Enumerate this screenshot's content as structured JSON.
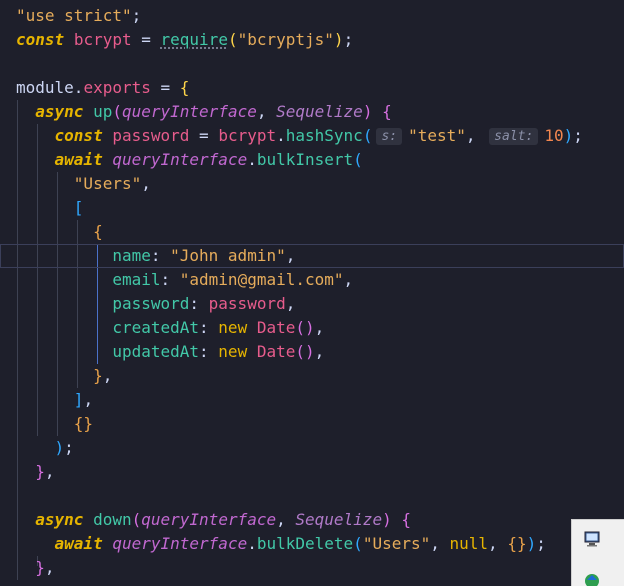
{
  "editor": {
    "lines": [
      {
        "tokens": [
          {
            "t": "\"use strict\"",
            "c": "str"
          },
          {
            "t": ";",
            "c": "pl"
          }
        ]
      },
      {
        "tokens": [
          {
            "t": "const",
            "c": "kw"
          },
          {
            "t": " ",
            "c": "pl"
          },
          {
            "t": "bcrypt",
            "c": "var"
          },
          {
            "t": " = ",
            "c": "pl"
          },
          {
            "t": "require",
            "c": "fn squiggle"
          },
          {
            "t": "(",
            "c": "br1"
          },
          {
            "t": "\"bcryptjs\"",
            "c": "str"
          },
          {
            "t": ")",
            "c": "br1"
          },
          {
            "t": ";",
            "c": "pl"
          }
        ]
      },
      {
        "tokens": []
      },
      {
        "tokens": [
          {
            "t": "module",
            "c": "pl"
          },
          {
            "t": ".",
            "c": "pl"
          },
          {
            "t": "exports",
            "c": "var"
          },
          {
            "t": " = ",
            "c": "pl"
          },
          {
            "t": "{",
            "c": "br1"
          }
        ]
      },
      {
        "tokens": [
          {
            "t": "  ",
            "c": "pl"
          },
          {
            "t": "async",
            "c": "kw"
          },
          {
            "t": " ",
            "c": "pl"
          },
          {
            "t": "up",
            "c": "fn"
          },
          {
            "t": "(",
            "c": "br2"
          },
          {
            "t": "queryInterface",
            "c": "prm"
          },
          {
            "t": ", ",
            "c": "pl"
          },
          {
            "t": "Sequelize",
            "c": "prm2"
          },
          {
            "t": ")",
            "c": "br2"
          },
          {
            "t": " ",
            "c": "pl"
          },
          {
            "t": "{",
            "c": "br2"
          }
        ]
      },
      {
        "tokens": [
          {
            "t": "    ",
            "c": "pl"
          },
          {
            "t": "const",
            "c": "kw"
          },
          {
            "t": " ",
            "c": "pl"
          },
          {
            "t": "password",
            "c": "var"
          },
          {
            "t": " = ",
            "c": "pl"
          },
          {
            "t": "bcrypt",
            "c": "var"
          },
          {
            "t": ".",
            "c": "pl"
          },
          {
            "t": "hashSync",
            "c": "fn"
          },
          {
            "t": "(",
            "c": "br3"
          },
          {
            "t": "s:",
            "c": "hint"
          },
          {
            "t": "\"test\"",
            "c": "str"
          },
          {
            "t": ", ",
            "c": "pl"
          },
          {
            "t": "salt:",
            "c": "hint"
          },
          {
            "t": "10",
            "c": "num"
          },
          {
            "t": ")",
            "c": "br3"
          },
          {
            "t": ";",
            "c": "pl"
          }
        ]
      },
      {
        "tokens": [
          {
            "t": "    ",
            "c": "pl"
          },
          {
            "t": "await",
            "c": "kw"
          },
          {
            "t": " ",
            "c": "pl"
          },
          {
            "t": "queryInterface",
            "c": "prm"
          },
          {
            "t": ".",
            "c": "pl"
          },
          {
            "t": "bulkInsert",
            "c": "fn"
          },
          {
            "t": "(",
            "c": "br3"
          }
        ]
      },
      {
        "tokens": [
          {
            "t": "      ",
            "c": "pl"
          },
          {
            "t": "\"Users\"",
            "c": "str"
          },
          {
            "t": ",",
            "c": "pl"
          }
        ]
      },
      {
        "tokens": [
          {
            "t": "      ",
            "c": "pl"
          },
          {
            "t": "[",
            "c": "br3"
          }
        ]
      },
      {
        "tokens": [
          {
            "t": "        ",
            "c": "pl"
          },
          {
            "t": "{",
            "c": "br4"
          }
        ]
      },
      {
        "tokens": [
          {
            "t": "          ",
            "c": "pl"
          },
          {
            "t": "name",
            "c": "prop"
          },
          {
            "t": ": ",
            "c": "pl"
          },
          {
            "t": "\"John admin\"",
            "c": "str"
          },
          {
            "t": ",",
            "c": "pl"
          }
        ],
        "current": true
      },
      {
        "tokens": [
          {
            "t": "          ",
            "c": "pl"
          },
          {
            "t": "email",
            "c": "prop"
          },
          {
            "t": ": ",
            "c": "pl"
          },
          {
            "t": "\"admin@gmail.com\"",
            "c": "str"
          },
          {
            "t": ",",
            "c": "pl"
          }
        ]
      },
      {
        "tokens": [
          {
            "t": "          ",
            "c": "pl"
          },
          {
            "t": "password",
            "c": "prop"
          },
          {
            "t": ": ",
            "c": "pl"
          },
          {
            "t": "password",
            "c": "var"
          },
          {
            "t": ",",
            "c": "pl"
          }
        ]
      },
      {
        "tokens": [
          {
            "t": "          ",
            "c": "pl"
          },
          {
            "t": "createdAt",
            "c": "prop"
          },
          {
            "t": ": ",
            "c": "pl"
          },
          {
            "t": "new",
            "c": "new"
          },
          {
            "t": " ",
            "c": "pl"
          },
          {
            "t": "Date",
            "c": "cls"
          },
          {
            "t": "()",
            "c": "br2"
          },
          {
            "t": ",",
            "c": "pl"
          }
        ]
      },
      {
        "tokens": [
          {
            "t": "          ",
            "c": "pl"
          },
          {
            "t": "updatedAt",
            "c": "prop"
          },
          {
            "t": ": ",
            "c": "pl"
          },
          {
            "t": "new",
            "c": "new"
          },
          {
            "t": " ",
            "c": "pl"
          },
          {
            "t": "Date",
            "c": "cls"
          },
          {
            "t": "()",
            "c": "br2"
          },
          {
            "t": ",",
            "c": "pl"
          }
        ]
      },
      {
        "tokens": [
          {
            "t": "        ",
            "c": "pl"
          },
          {
            "t": "}",
            "c": "br4"
          },
          {
            "t": ",",
            "c": "pl"
          }
        ]
      },
      {
        "tokens": [
          {
            "t": "      ",
            "c": "pl"
          },
          {
            "t": "]",
            "c": "br3"
          },
          {
            "t": ",",
            "c": "pl"
          }
        ]
      },
      {
        "tokens": [
          {
            "t": "      ",
            "c": "pl"
          },
          {
            "t": "{}",
            "c": "br4"
          }
        ]
      },
      {
        "tokens": [
          {
            "t": "    ",
            "c": "pl"
          },
          {
            "t": ")",
            "c": "br3"
          },
          {
            "t": ";",
            "c": "pl"
          }
        ]
      },
      {
        "tokens": [
          {
            "t": "  ",
            "c": "pl"
          },
          {
            "t": "}",
            "c": "br2"
          },
          {
            "t": ",",
            "c": "pl"
          }
        ]
      },
      {
        "tokens": []
      },
      {
        "tokens": [
          {
            "t": "  ",
            "c": "pl"
          },
          {
            "t": "async",
            "c": "kw"
          },
          {
            "t": " ",
            "c": "pl"
          },
          {
            "t": "down",
            "c": "fn"
          },
          {
            "t": "(",
            "c": "br2"
          },
          {
            "t": "queryInterface",
            "c": "prm"
          },
          {
            "t": ", ",
            "c": "pl"
          },
          {
            "t": "Sequelize",
            "c": "prm2"
          },
          {
            "t": ")",
            "c": "br2"
          },
          {
            "t": " ",
            "c": "pl"
          },
          {
            "t": "{",
            "c": "br2"
          }
        ]
      },
      {
        "tokens": [
          {
            "t": "    ",
            "c": "pl"
          },
          {
            "t": "await",
            "c": "kw"
          },
          {
            "t": " ",
            "c": "pl"
          },
          {
            "t": "queryInterface",
            "c": "prm"
          },
          {
            "t": ".",
            "c": "pl"
          },
          {
            "t": "bulkDelete",
            "c": "fn"
          },
          {
            "t": "(",
            "c": "br3"
          },
          {
            "t": "\"Users\"",
            "c": "str"
          },
          {
            "t": ", ",
            "c": "pl"
          },
          {
            "t": "null",
            "c": "new"
          },
          {
            "t": ", ",
            "c": "pl"
          },
          {
            "t": "{}",
            "c": "br4"
          },
          {
            "t": ")",
            "c": "br3"
          },
          {
            "t": ";",
            "c": "pl"
          }
        ]
      },
      {
        "tokens": [
          {
            "t": "  ",
            "c": "pl"
          },
          {
            "t": "}",
            "c": "br2"
          },
          {
            "t": ",",
            "c": "pl"
          }
        ]
      }
    ]
  },
  "tray": {
    "icons": [
      "monitor-icon",
      "network-icon"
    ]
  },
  "colors": {
    "background": "#1e1f2b",
    "keyword": "#e6b400",
    "string": "#e6ac5b",
    "function": "#42c8a8",
    "variable": "#e75c8c",
    "parameter": "#c168d0"
  }
}
